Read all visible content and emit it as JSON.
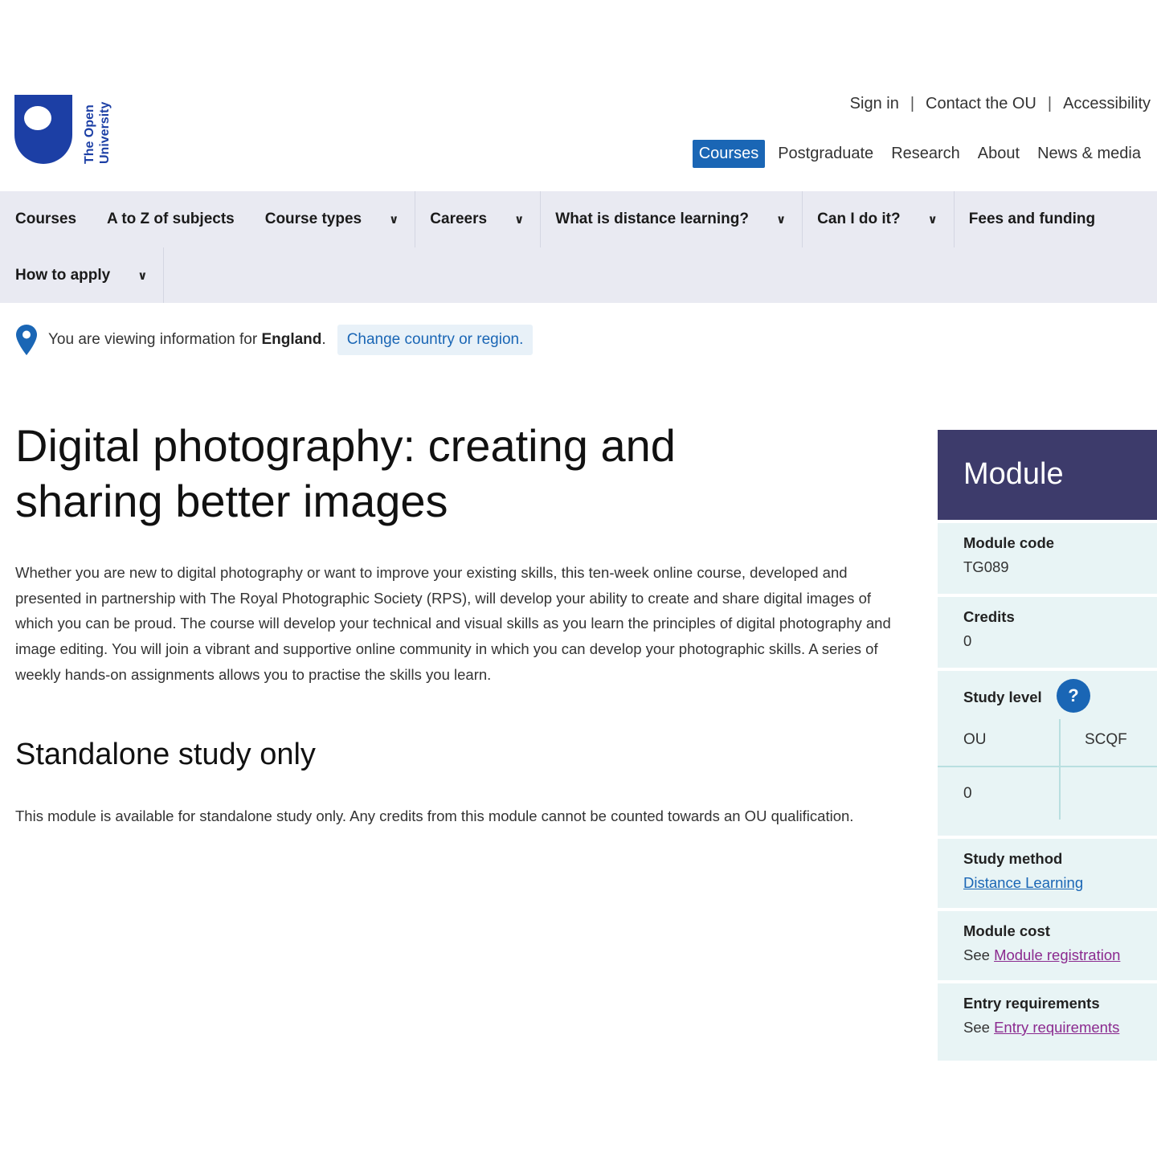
{
  "brand": {
    "logo_line1": "The Open",
    "logo_line2": "University",
    "color": "#1c3fa5"
  },
  "utility_nav": {
    "sign_in": "Sign in",
    "contact": "Contact the OU",
    "accessibility": "Accessibility",
    "separator": "|"
  },
  "site_nav": {
    "items": [
      "Courses",
      "Postgraduate",
      "Research",
      "About",
      "News & media"
    ],
    "active": "Courses"
  },
  "main_nav": {
    "courses": "Courses",
    "atoz": "A to Z of subjects",
    "course_types": "Course types",
    "careers": "Careers",
    "distance": "What is distance learning?",
    "can_i": "Can I do it?",
    "fees": "Fees and funding",
    "how_to_apply": "How to apply"
  },
  "location": {
    "prefix": "You are viewing information for",
    "region": "England",
    "suffix": ".",
    "change_link": "Change country or region."
  },
  "page": {
    "title": "Digital photography: creating and sharing better images",
    "intro": "Whether you are new to digital photography or want to improve your existing skills, this ten-week online course, developed and presented in partnership with The Royal Photographic Society (RPS), will develop your ability to create and share digital images of which you can be proud. The course will develop your technical and visual skills as you learn the principles of digital photography and image editing. You will join a vibrant and supportive online community in which you can develop your photographic skills. A series of weekly hands-on assignments allows you to practise the skills you learn.",
    "standalone_heading": "Standalone study only",
    "standalone_text": "This module is available for standalone study only. Any credits from this module cannot be counted towards an OU qualification."
  },
  "module": {
    "heading": "Module",
    "code_label": "Module code",
    "code_value": "TG089",
    "credits_label": "Credits",
    "credits_value": "0",
    "level_label": "Study level",
    "level_help": "?",
    "level_col_ou": "OU",
    "level_col_scqf": "SCQF",
    "level_ou_value": "0",
    "method_label": "Study method",
    "method_value": "Distance Learning",
    "cost_label": "Module cost",
    "cost_prefix": "See",
    "cost_link": "Module registration",
    "entry_label": "Entry requirements",
    "entry_prefix": "See",
    "entry_link": "Entry requirements",
    "colors": {
      "header": "#3d3b6b",
      "panel": "#e8f4f5",
      "link": "#1a66b5",
      "visited": "#8b2a8f"
    }
  }
}
